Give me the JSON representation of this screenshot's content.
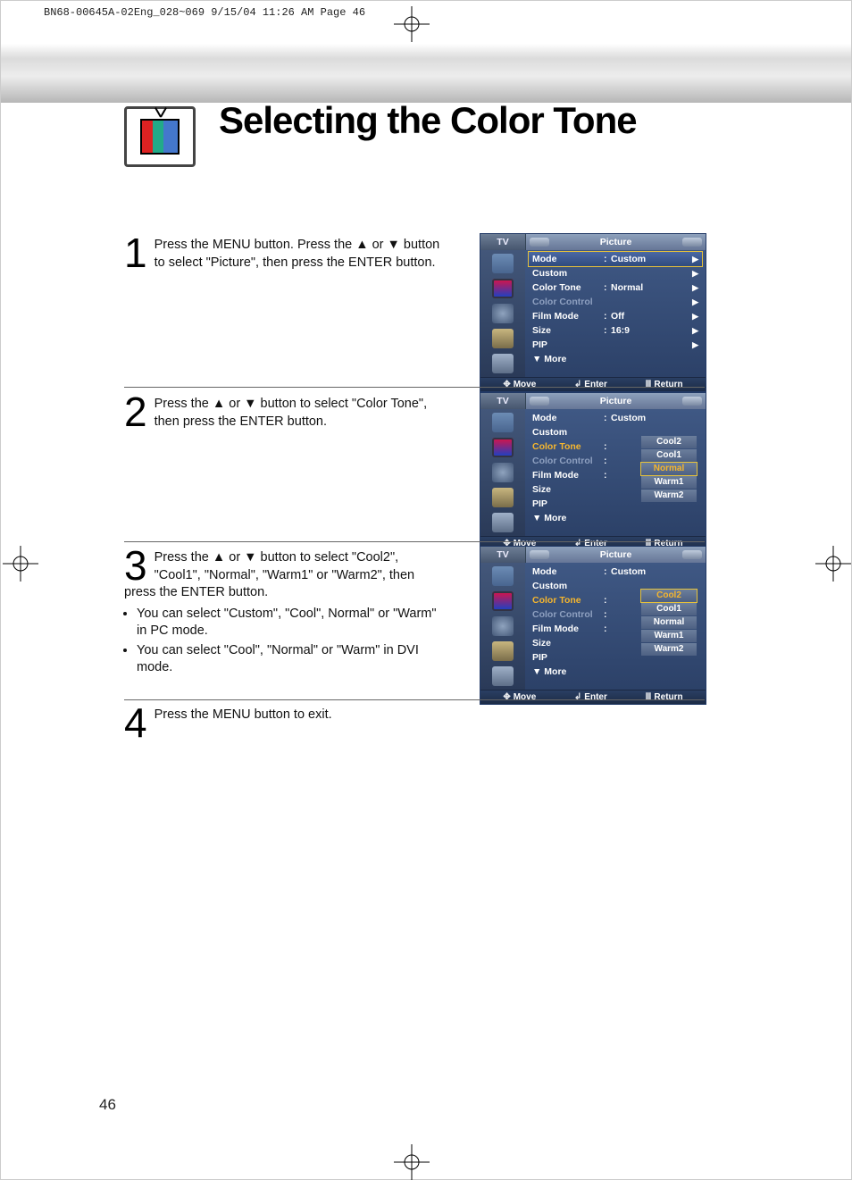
{
  "print_header": "BN68-00645A-02Eng_028~069  9/15/04  11:26 AM  Page 46",
  "title": "Selecting the Color Tone",
  "steps": {
    "s1": {
      "num": "1",
      "text": "Press the MENU button. Press the ▲ or ▼ button to select \"Picture\", then press the ENTER button."
    },
    "s2": {
      "num": "2",
      "text": "Press the ▲ or ▼ button to select \"Color Tone\", then press the ENTER button."
    },
    "s3": {
      "num": "3",
      "text": "Press the ▲ or ▼ button to select \"Cool2\", \"Cool1\", \"Normal\", \"Warm1\" or \"Warm2\",  then press the ENTER button.",
      "b1": "You can select \"Custom\", \"Cool\", Normal\" or \"Warm\" in PC mode.",
      "b2": "You can select \"Cool\", \"Normal\" or \"Warm\" in DVI mode."
    },
    "s4": {
      "num": "4",
      "text": "Press the MENU button to exit."
    }
  },
  "osd_common": {
    "tv": "TV",
    "title": "Picture",
    "items": {
      "mode": "Mode",
      "custom": "Custom",
      "colortone": "Color Tone",
      "colorcontrol": "Color Control",
      "filmmode": "Film Mode",
      "size": "Size",
      "pip": "PIP",
      "more": "▼ More"
    },
    "footer": {
      "move": "Move",
      "enter": "Enter",
      "return": "Return"
    }
  },
  "osd1_values": {
    "mode": "Custom",
    "colortone": "Normal",
    "filmmode": "Off",
    "size": "16:9"
  },
  "osd2_values": {
    "mode": "Custom"
  },
  "popup": {
    "o1": "Cool2",
    "o2": "Cool1",
    "o3": "Normal",
    "o4": "Warm1",
    "o5": "Warm2"
  },
  "page_number": "46"
}
